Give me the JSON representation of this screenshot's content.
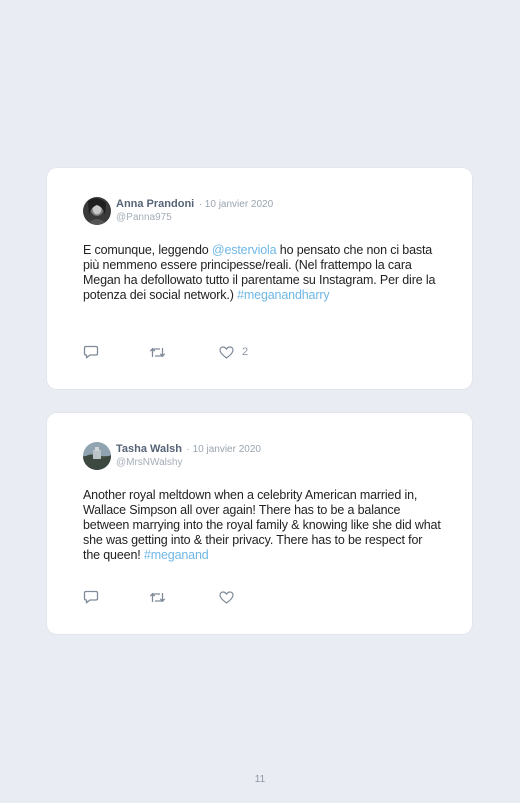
{
  "tweets": [
    {
      "name": "Anna Prandoni",
      "date": "· 10 janvier 2020",
      "handle": "@Panna975",
      "text_parts": [
        {
          "text": "E comunque, leggendo ",
          "type": "text"
        },
        {
          "text": "@esterviola",
          "type": "mention"
        },
        {
          "text": " ho pensato che non ci basta più nemmeno essere principesse/reali. (Nel frattempo la cara Megan ha defollowato tutto il parentame su Instagram. Per dire la potenza dei social network.) ",
          "type": "text"
        },
        {
          "text": "#meganandharry",
          "type": "hashtag"
        }
      ],
      "like_count": "2"
    },
    {
      "name": "Tasha Walsh",
      "date": "· 10 janvier 2020",
      "handle": "@MrsNWalshy",
      "text_parts": [
        {
          "text": "Another royal meltdown when a celebrity American married in, Wallace Simpson all over again! There has to be a balance between marrying into the royal family & knowing like she did what she was getting into & their privacy. There has to be respect for the queen! ",
          "type": "text"
        },
        {
          "text": "#meganand",
          "type": "hashtag"
        }
      ],
      "like_count": ""
    }
  ],
  "icons": {
    "reply": "speech-bubble-outline",
    "retweet": "retweet-arrows",
    "like": "heart-outline"
  },
  "colors": {
    "background": "#e9ecf2",
    "card": "#ffffff",
    "link": "#6fb7e6",
    "name": "#566477",
    "muted": "#9aa4b0"
  },
  "page_number": "11"
}
